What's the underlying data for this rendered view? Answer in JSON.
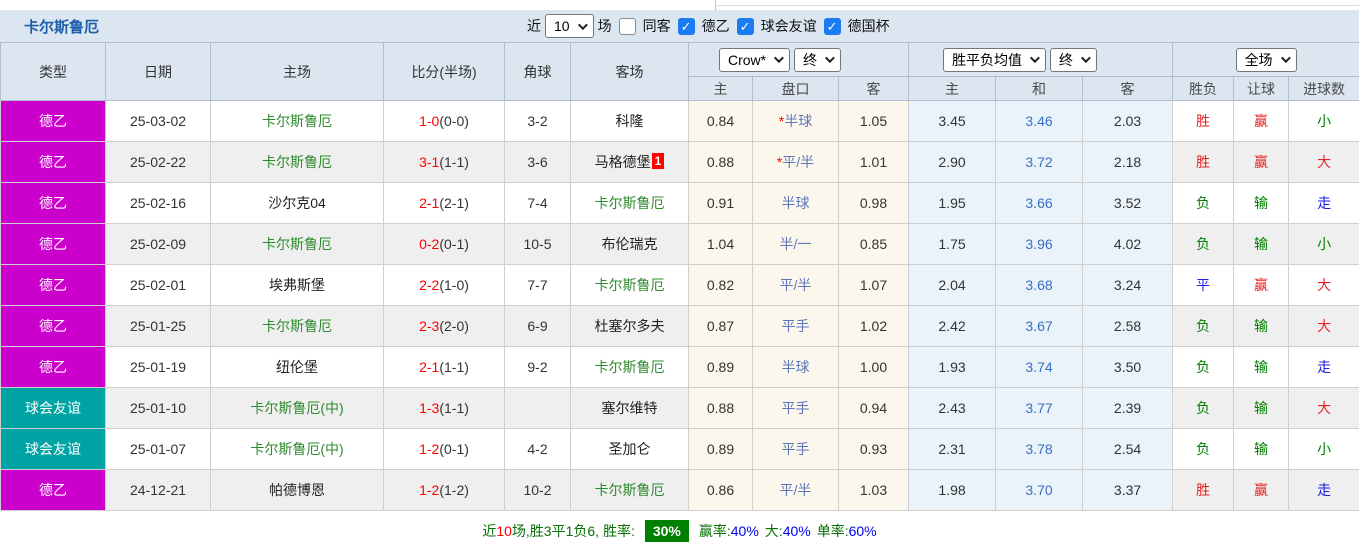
{
  "colors": {
    "league_de2": "#cc00cc",
    "friendly": "#00a3a3",
    "title_blue": "#1d5fa9",
    "team_green": "#2e8b2e",
    "score_red": "#ff0000",
    "winrate_badge_green": "#008000",
    "crow_col_bg": "#fcf7ec",
    "avg_col_bg": "#e9f3f9",
    "header_bg": "#dce6f1"
  },
  "title": "卡尔斯鲁厄",
  "filters": {
    "recent_label": "近",
    "recent_value": "10",
    "matches_label": "场",
    "same_venue": {
      "label": "同客",
      "checked": false
    },
    "leagues": [
      {
        "label": "德乙",
        "checked": true
      },
      {
        "label": "球会友谊",
        "checked": true
      },
      {
        "label": "德国杯",
        "checked": true
      }
    ]
  },
  "header": {
    "columns": [
      "类型",
      "日期",
      "主场",
      "比分(半场)",
      "角球",
      "客场"
    ],
    "dropdowns": [
      {
        "label": "Crow*"
      },
      {
        "label": "终"
      },
      {
        "label": "胜平负均值"
      },
      {
        "label": "终"
      },
      {
        "label": "全场"
      }
    ],
    "odds_columns": [
      "主",
      "盘口",
      "客",
      "主",
      "和",
      "客",
      "胜负",
      "让球",
      "进球数"
    ]
  },
  "rows": [
    {
      "type": "德乙",
      "type_bg": "#cc00cc",
      "date": "25-03-02",
      "home": "卡尔斯鲁厄",
      "home_c": "green",
      "score_ft": "1-0",
      "score_ht": "(0-0)",
      "corners": "3-2",
      "away": "科隆",
      "away_c": "dark",
      "away_badge": "",
      "odds_home": "0.84",
      "handicap_star": "*",
      "handicap": "半球",
      "odds_away": "1.05",
      "avg_home": "3.45",
      "avg_draw": "3.46",
      "avg_away": "2.03",
      "result": "胜",
      "result_c": "r",
      "hres": "赢",
      "hres_c": "r",
      "goals": "小",
      "goals_c": "g"
    },
    {
      "type": "德乙",
      "type_bg": "#cc00cc",
      "date": "25-02-22",
      "home": "卡尔斯鲁厄",
      "home_c": "green",
      "score_ft": "3-1",
      "score_ht": "(1-1)",
      "corners": "3-6",
      "away": "马格德堡",
      "away_c": "dark",
      "away_badge": "1",
      "odds_home": "0.88",
      "handicap_star": "*",
      "handicap": "平/半",
      "odds_away": "1.01",
      "avg_home": "2.90",
      "avg_draw": "3.72",
      "avg_away": "2.18",
      "result": "胜",
      "result_c": "r",
      "hres": "赢",
      "hres_c": "r",
      "goals": "大",
      "goals_c": "r"
    },
    {
      "type": "德乙",
      "type_bg": "#cc00cc",
      "date": "25-02-16",
      "home": "沙尔克04",
      "home_c": "dark",
      "score_ft": "2-1",
      "score_ht": "(2-1)",
      "corners": "7-4",
      "away": "卡尔斯鲁厄",
      "away_c": "green",
      "away_badge": "",
      "odds_home": "0.91",
      "handicap_star": "",
      "handicap": "半球",
      "odds_away": "0.98",
      "avg_home": "1.95",
      "avg_draw": "3.66",
      "avg_away": "3.52",
      "result": "负",
      "result_c": "g",
      "hres": "输",
      "hres_c": "g",
      "goals": "走",
      "goals_c": "b"
    },
    {
      "type": "德乙",
      "type_bg": "#cc00cc",
      "date": "25-02-09",
      "home": "卡尔斯鲁厄",
      "home_c": "green",
      "score_ft": "0-2",
      "score_ht": "(0-1)",
      "corners": "10-5",
      "away": "布伦瑞克",
      "away_c": "dark",
      "away_badge": "",
      "odds_home": "1.04",
      "handicap_star": "",
      "handicap": "半/一",
      "odds_away": "0.85",
      "avg_home": "1.75",
      "avg_draw": "3.96",
      "avg_away": "4.02",
      "result": "负",
      "result_c": "g",
      "hres": "输",
      "hres_c": "g",
      "goals": "小",
      "goals_c": "g"
    },
    {
      "type": "德乙",
      "type_bg": "#cc00cc",
      "date": "25-02-01",
      "home": "埃弗斯堡",
      "home_c": "dark",
      "score_ft": "2-2",
      "score_ht": "(1-0)",
      "corners": "7-7",
      "away": "卡尔斯鲁厄",
      "away_c": "green",
      "away_badge": "",
      "odds_home": "0.82",
      "handicap_star": "",
      "handicap": "平/半",
      "odds_away": "1.07",
      "avg_home": "2.04",
      "avg_draw": "3.68",
      "avg_away": "3.24",
      "result": "平",
      "result_c": "b",
      "hres": "赢",
      "hres_c": "r",
      "goals": "大",
      "goals_c": "r"
    },
    {
      "type": "德乙",
      "type_bg": "#cc00cc",
      "date": "25-01-25",
      "home": "卡尔斯鲁厄",
      "home_c": "green",
      "score_ft": "2-3",
      "score_ht": "(2-0)",
      "corners": "6-9",
      "away": "杜塞尔多夫",
      "away_c": "dark",
      "away_badge": "",
      "odds_home": "0.87",
      "handicap_star": "",
      "handicap": "平手",
      "odds_away": "1.02",
      "avg_home": "2.42",
      "avg_draw": "3.67",
      "avg_away": "2.58",
      "result": "负",
      "result_c": "g",
      "hres": "输",
      "hres_c": "g",
      "goals": "大",
      "goals_c": "r"
    },
    {
      "type": "德乙",
      "type_bg": "#cc00cc",
      "date": "25-01-19",
      "home": "纽伦堡",
      "home_c": "dark",
      "score_ft": "2-1",
      "score_ht": "(1-1)",
      "corners": "9-2",
      "away": "卡尔斯鲁厄",
      "away_c": "green",
      "away_badge": "",
      "odds_home": "0.89",
      "handicap_star": "",
      "handicap": "半球",
      "odds_away": "1.00",
      "avg_home": "1.93",
      "avg_draw": "3.74",
      "avg_away": "3.50",
      "result": "负",
      "result_c": "g",
      "hres": "输",
      "hres_c": "g",
      "goals": "走",
      "goals_c": "b"
    },
    {
      "type": "球会友谊",
      "type_bg": "#00a3a3",
      "date": "25-01-10",
      "home": "卡尔斯鲁厄(中)",
      "home_c": "green",
      "score_ft": "1-3",
      "score_ht": "(1-1)",
      "corners": "",
      "away": "塞尔维特",
      "away_c": "dark",
      "away_badge": "",
      "odds_home": "0.88",
      "handicap_star": "",
      "handicap": "平手",
      "odds_away": "0.94",
      "avg_home": "2.43",
      "avg_draw": "3.77",
      "avg_away": "2.39",
      "result": "负",
      "result_c": "g",
      "hres": "输",
      "hres_c": "g",
      "goals": "大",
      "goals_c": "r"
    },
    {
      "type": "球会友谊",
      "type_bg": "#00a3a3",
      "date": "25-01-07",
      "home": "卡尔斯鲁厄(中)",
      "home_c": "green",
      "score_ft": "1-2",
      "score_ht": "(0-1)",
      "corners": "4-2",
      "away": "圣加仑",
      "away_c": "dark",
      "away_badge": "",
      "odds_home": "0.89",
      "handicap_star": "",
      "handicap": "平手",
      "odds_away": "0.93",
      "avg_home": "2.31",
      "avg_draw": "3.78",
      "avg_away": "2.54",
      "result": "负",
      "result_c": "g",
      "hres": "输",
      "hres_c": "g",
      "goals": "小",
      "goals_c": "g"
    },
    {
      "type": "德乙",
      "type_bg": "#cc00cc",
      "date": "24-12-21",
      "home": "帕德博恩",
      "home_c": "dark",
      "score_ft": "1-2",
      "score_ht": "(1-2)",
      "corners": "10-2",
      "away": "卡尔斯鲁厄",
      "away_c": "green",
      "away_badge": "",
      "odds_home": "0.86",
      "handicap_star": "",
      "handicap": "平/半",
      "odds_away": "1.03",
      "avg_home": "1.98",
      "avg_draw": "3.70",
      "avg_away": "3.37",
      "result": "胜",
      "result_c": "r",
      "hres": "赢",
      "hres_c": "r",
      "goals": "走",
      "goals_c": "b"
    }
  ],
  "footer": {
    "summary_pre": "近",
    "summary_count": "10",
    "summary_post": "场,胜3平1负6, 胜率:",
    "win_rate": "30%",
    "seg2_label": "赢率:",
    "seg2_value": "40%",
    "seg3_label": "大:",
    "seg3_value": "40%",
    "seg4_label": "单率:",
    "seg4_value": "60%"
  }
}
